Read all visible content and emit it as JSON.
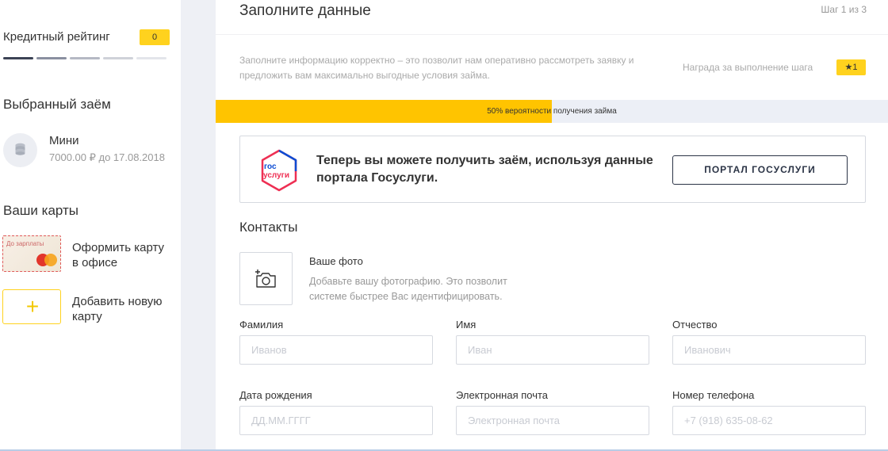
{
  "sidebar": {
    "credit": {
      "label": "Кредитный рейтинг",
      "value": "0",
      "segments_filled": 1,
      "segments_total": 5
    },
    "loan_section_title": "Выбранный заём",
    "loan": {
      "name": "Мини",
      "details": "7000.00 ₽ до 17.08.2018",
      "icon": "coins-icon"
    },
    "cards_section_title": "Ваши карты",
    "cards": [
      {
        "label": "Оформить карту в офисе",
        "brand": "До зарплаты"
      },
      {
        "label": "Добавить новую карту",
        "icon": "plus-icon"
      }
    ]
  },
  "main": {
    "title": "Заполните данные",
    "step": "Шаг 1 из 3",
    "info": "Заполните информацию корректно – это позволит нам оперативно рассмотреть заявку и предложить вам максимально выгодные условия займа.",
    "reward_label": "Награда за выполнение шага",
    "reward_value": "★1",
    "progress": {
      "percent": 50,
      "text": "50% вероятности получения займа"
    },
    "gosuslugi": {
      "logo_line1": "гос",
      "logo_line2": "услуги",
      "text": "Теперь вы можете получить заём, используя данные портала Госуслуги.",
      "button": "ПОРТАЛ ГОСУСЛУГИ"
    },
    "contacts_title": "Контакты",
    "photo": {
      "label": "Ваше фото",
      "hint": "Добавьте вашу фотографию. Это позволит системе быстрее Вас идентифицировать.",
      "icon": "camera-add-icon"
    },
    "fields": {
      "last_name": {
        "label": "Фамилия",
        "placeholder": "Иванов"
      },
      "first_name": {
        "label": "Имя",
        "placeholder": "Иван"
      },
      "middle_name": {
        "label": "Отчество",
        "placeholder": "Иванович"
      },
      "birth_date": {
        "label": "Дата рождения",
        "placeholder": "ДД.ММ.ГГГГ"
      },
      "email": {
        "label": "Электронная почта",
        "placeholder": "Электронная почта"
      },
      "phone": {
        "label": "Номер телефона",
        "placeholder": "+7 (918) 635-08-62"
      }
    }
  },
  "colors": {
    "accent": "#ffd21e",
    "progress": "#ffc400",
    "dark": "#2b3446",
    "gos_blue": "#0d4cd3",
    "gos_red": "#ee2f53"
  }
}
